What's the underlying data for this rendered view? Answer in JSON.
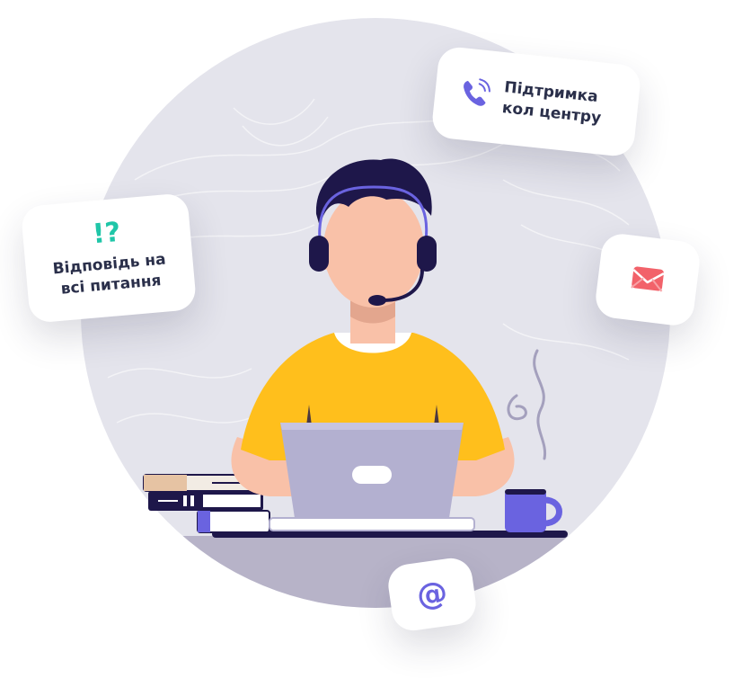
{
  "cards": {
    "call_center": {
      "line1": "Підтримка",
      "line2": "кол центру",
      "icon": "phone-icon"
    },
    "answers": {
      "marks": "!?",
      "line1": "Відповідь на",
      "line2": "всі питання"
    },
    "mail": {
      "icon": "envelope-icon"
    },
    "email": {
      "glyph": "@",
      "icon": "at-sign-icon"
    }
  },
  "colors": {
    "circle": "#e4e4ec",
    "desk": "#b7b3c8",
    "shirt": "#ffbf1c",
    "skin": "#f9c1a8",
    "hair": "#1e174a",
    "laptop": "#b3b0d0",
    "accent": "#6a63e0",
    "mail": "#f2626a",
    "teal": "#1fc6a8"
  }
}
